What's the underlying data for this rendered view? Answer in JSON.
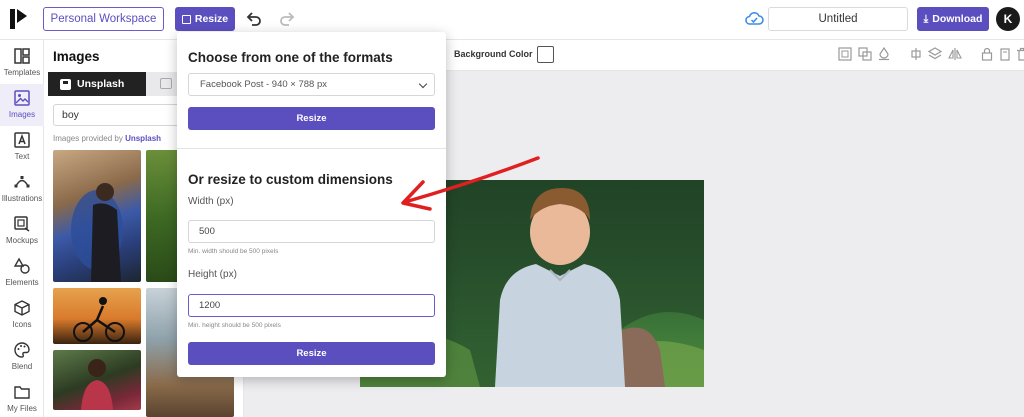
{
  "topbar": {
    "workspace_label": "Personal Workspace",
    "resize_label": "Resize",
    "document_title": "Untitled",
    "download_label": "Download",
    "avatar_initial": "K",
    "logo_icon": "brand-logo",
    "undo_icon": "undo-icon",
    "redo_icon": "redo-icon",
    "cloud_icon": "cloud-sync-icon"
  },
  "sidebar": {
    "items": [
      {
        "label": "Templates",
        "icon": "templates-icon"
      },
      {
        "label": "Images",
        "icon": "image-icon",
        "active": true
      },
      {
        "label": "Text",
        "icon": "text-icon"
      },
      {
        "label": "Illustrations",
        "icon": "illustrations-icon"
      },
      {
        "label": "Mockups",
        "icon": "mockups-icon"
      },
      {
        "label": "Elements",
        "icon": "elements-icon"
      },
      {
        "label": "Icons",
        "icon": "cube-icon"
      },
      {
        "label": "Blend",
        "icon": "palette-icon"
      },
      {
        "label": "My Files",
        "icon": "folder-icon"
      }
    ]
  },
  "images_panel": {
    "title": "Images",
    "tab_unsplash": "Unsplash",
    "search_value": "boy",
    "credit_prefix": "Images provided by",
    "credit_link": "Unsplash"
  },
  "properties": {
    "background_color_label": "Background Color",
    "background_color_value": "#ffffff"
  },
  "resize_dialog": {
    "formats_heading": "Choose from one of the formats",
    "selected_format": "Facebook Post - 940 × 788 px",
    "format_resize_label": "Resize",
    "custom_heading": "Or resize to custom dimensions",
    "width_label": "Width (px)",
    "width_value": "500",
    "width_hint": "Min. width should be 500 pixels",
    "height_label": "Height (px)",
    "height_value": "1200",
    "height_hint": "Min. height should be 500 pixels",
    "custom_resize_label": "Resize"
  },
  "colors": {
    "accent": "#5b4fc0",
    "annotation_arrow": "#e02020"
  }
}
